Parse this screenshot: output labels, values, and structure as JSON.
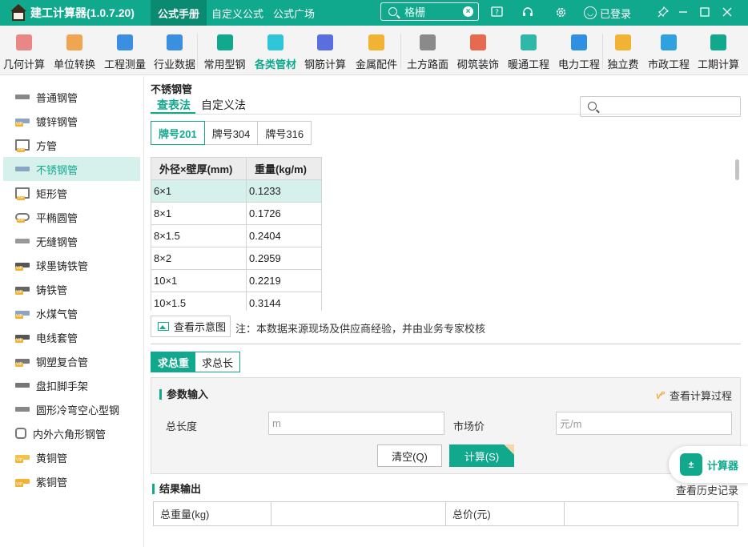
{
  "app": {
    "title": "建工计算器(1.0.7.20)"
  },
  "top_tabs": [
    {
      "label": "公式手册",
      "active": true
    },
    {
      "label": "自定义公式",
      "active": false
    },
    {
      "label": "公式广场",
      "active": false
    }
  ],
  "search": {
    "placeholder": "格栅"
  },
  "login": {
    "label": "已登录"
  },
  "toolbar": [
    {
      "label": "几何计算",
      "icon": "cube-icon",
      "color": "#e98787"
    },
    {
      "label": "单位转换",
      "icon": "unit-cm-icon",
      "color": "#f0a552"
    },
    {
      "label": "工程测量",
      "icon": "axis-measure-icon",
      "color": "#3b8fe0"
    },
    {
      "label": "行业数据",
      "icon": "bar-chart-icon",
      "color": "#3b8fe0"
    },
    {
      "label": "常用型钢",
      "icon": "wrench-icon",
      "color": "#11a98d"
    },
    {
      "label": "各类管材",
      "icon": "pipe-icon",
      "color": "#2fc6d9"
    },
    {
      "label": "钢筋计算",
      "icon": "rebar-icon",
      "color": "#5b6ee0"
    },
    {
      "label": "金属配件",
      "icon": "hammer-icon",
      "color": "#f2b233"
    },
    {
      "label": "土方路面",
      "icon": "road-icon",
      "color": "#8a8a8a"
    },
    {
      "label": "砌筑装饰",
      "icon": "brick-icon",
      "color": "#e66a4f"
    },
    {
      "label": "暖通工程",
      "icon": "fan-icon",
      "color": "#2fb8a8"
    },
    {
      "label": "电力工程",
      "icon": "power-house-icon",
      "color": "#2f8fe0"
    },
    {
      "label": "独立费",
      "icon": "fee-chart-icon",
      "color": "#f2b233"
    },
    {
      "label": "市政工程",
      "icon": "municipal-icon",
      "color": "#2fa0e0"
    },
    {
      "label": "工期计算",
      "icon": "calendar-icon",
      "color": "#11a98d"
    }
  ],
  "toolbar_active": "各类管材",
  "sidebar": {
    "items": [
      {
        "label": "普通钢管",
        "icon": "steel-pipe-icon",
        "vip": false
      },
      {
        "label": "镀锌钢管",
        "icon": "galvanized-pipe-icon",
        "vip": true
      },
      {
        "label": "方管",
        "icon": "square-tube-icon",
        "vip": true
      },
      {
        "label": "不锈钢管",
        "icon": "stainless-pipe-icon",
        "vip": false,
        "active": true
      },
      {
        "label": "矩形管",
        "icon": "rectangular-tube-icon",
        "vip": true
      },
      {
        "label": "平椭圆管",
        "icon": "flat-oval-pipe-icon",
        "vip": true
      },
      {
        "label": "无缝钢管",
        "icon": "seamless-pipe-icon",
        "vip": false
      },
      {
        "label": "球墨铸铁管",
        "icon": "ductile-iron-pipe-icon",
        "vip": true
      },
      {
        "label": "铸铁管",
        "icon": "cast-iron-pipe-icon",
        "vip": true
      },
      {
        "label": "水煤气管",
        "icon": "gas-pipe-icon",
        "vip": true
      },
      {
        "label": "电线套管",
        "icon": "conduit-icon",
        "vip": true
      },
      {
        "label": "钢塑复合管",
        "icon": "composite-pipe-icon",
        "vip": true
      },
      {
        "label": "盘扣脚手架",
        "icon": "scaffold-icon",
        "vip": false
      },
      {
        "label": "圆形冷弯空心型钢",
        "icon": "round-hollow-steel-icon",
        "vip": false
      },
      {
        "label": "内外六角形钢管",
        "icon": "hexagon-pipe-icon",
        "vip": false
      },
      {
        "label": "黄铜管",
        "icon": "brass-pipe-icon",
        "vip": true
      },
      {
        "label": "紫铜管",
        "icon": "copper-pipe-icon",
        "vip": true
      }
    ]
  },
  "main": {
    "title": "不锈钢管",
    "tabs": [
      {
        "label": "查表法",
        "active": true
      },
      {
        "label": "自定义法",
        "active": false
      }
    ],
    "grades": [
      {
        "label": "牌号201",
        "active": true
      },
      {
        "label": "牌号304",
        "active": false
      },
      {
        "label": "牌号316",
        "active": false
      }
    ],
    "table": {
      "headers": [
        "外径×壁厚(mm)",
        "重量(kg/m)"
      ],
      "rows": [
        [
          "6×1",
          "0.1233"
        ],
        [
          "8×1",
          "0.1726"
        ],
        [
          "8×1.5",
          "0.2404"
        ],
        [
          "8×2",
          "0.2959"
        ],
        [
          "10×1",
          "0.2219"
        ],
        [
          "10×1.5",
          "0.3144"
        ]
      ]
    },
    "diagram_button": "查看示意图",
    "note": "注：本数据来源现场及供应商经验，并由业务专家校核"
  },
  "calc": {
    "modes": [
      {
        "label": "求总重",
        "active": true
      },
      {
        "label": "求总长",
        "active": false
      }
    ],
    "params_title": "参数输入",
    "view_process": "查看计算过程",
    "fields": {
      "length_label": "总长度",
      "length_placeholder": "m",
      "price_label": "市场价",
      "price_placeholder": "元/m"
    },
    "clear_button": "清空(Q)",
    "calc_button": "计算(S)",
    "result_title": "结果输出",
    "history": "查看历史记录",
    "result_cells": [
      "总重量(kg)",
      "",
      "总价(元)",
      ""
    ]
  },
  "float_calculator": {
    "label": "计算器"
  },
  "colors": {
    "accent": "#11a98d",
    "selected_bg": "#d6f0ec",
    "vip": "#f2b233"
  }
}
